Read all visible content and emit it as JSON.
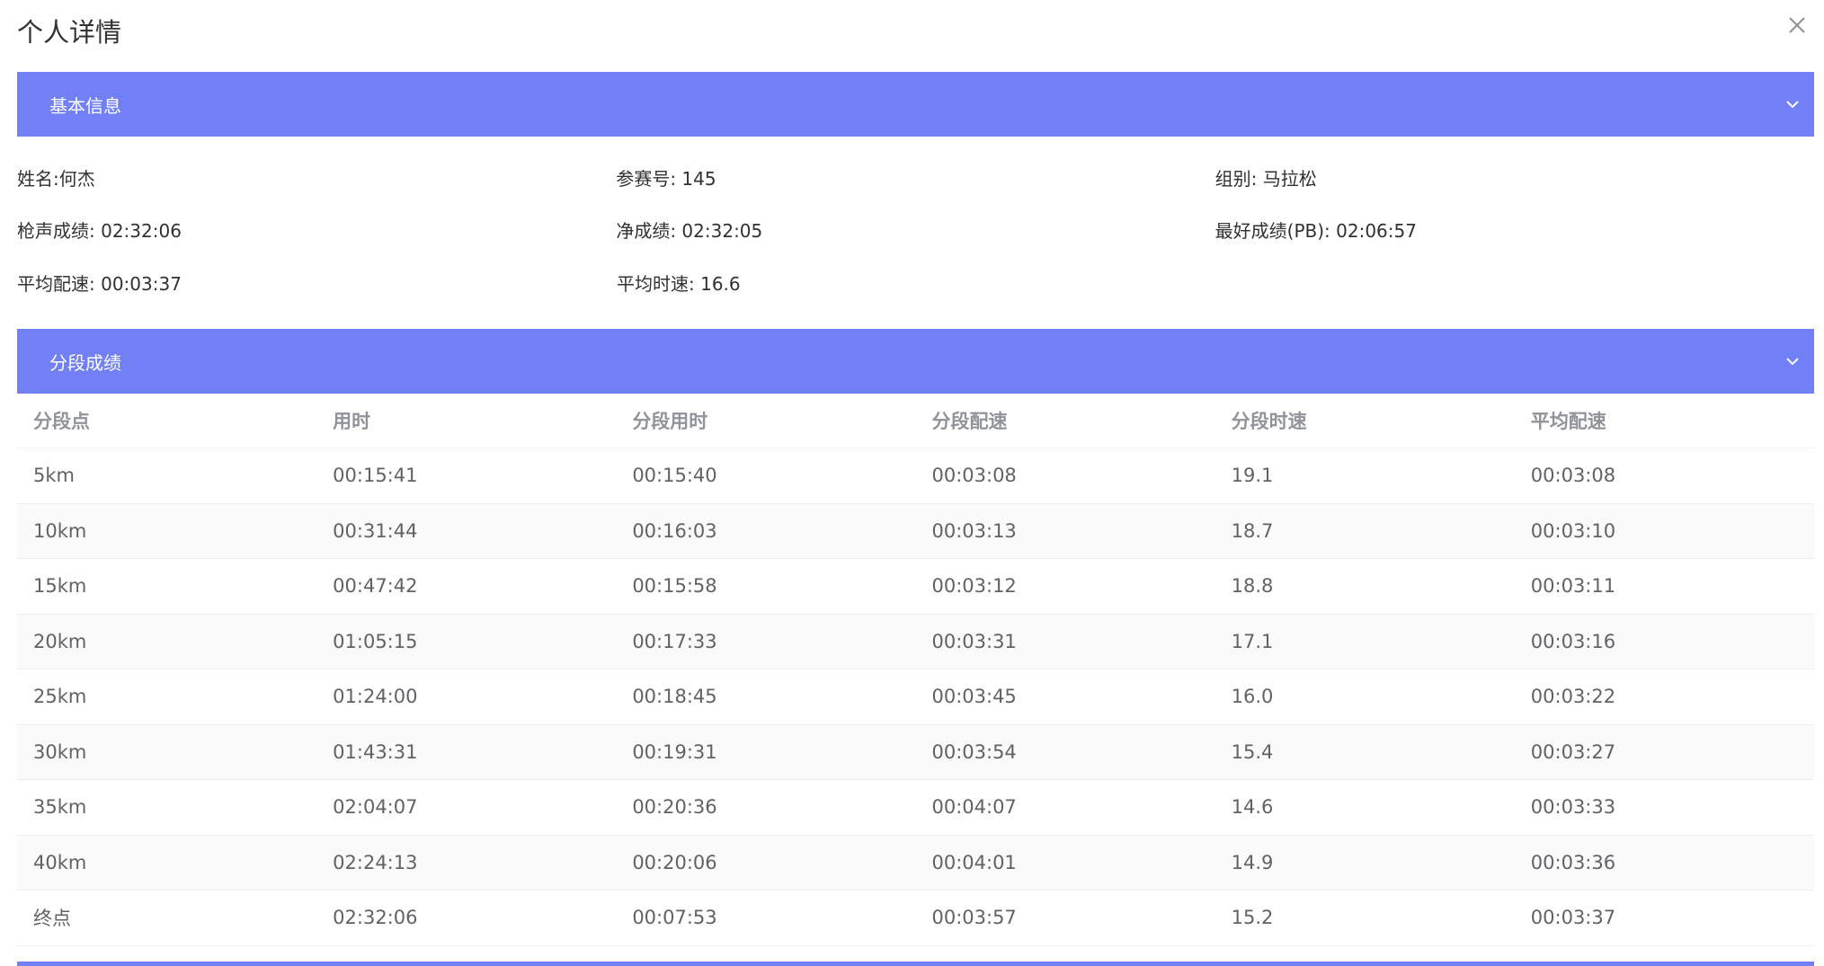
{
  "dialog": {
    "title": "个人详情"
  },
  "basic_panel": {
    "title": "基本信息",
    "rows": [
      [
        {
          "label": "姓名:",
          "value": "何杰"
        },
        {
          "label": "参赛号:",
          "value": " 145"
        },
        {
          "label": "组别:",
          "value": " 马拉松"
        }
      ],
      [
        {
          "label": "枪声成绩:",
          "value": " 02:32:06"
        },
        {
          "label": "净成绩:",
          "value": " 02:32:05"
        },
        {
          "label": "最好成绩(PB):",
          "value": " 02:06:57"
        }
      ],
      [
        {
          "label": "平均配速:",
          "value": " 00:03:37"
        },
        {
          "label": "平均时速:",
          "value": " 16.6"
        }
      ]
    ]
  },
  "split_panel": {
    "title": "分段成绩",
    "columns": [
      "分段点",
      "用时",
      "分段用时",
      "分段配速",
      "分段时速",
      "平均配速"
    ],
    "rows": [
      [
        "5km",
        "00:15:41",
        "00:15:40",
        "00:03:08",
        "19.1",
        "00:03:08"
      ],
      [
        "10km",
        "00:31:44",
        "00:16:03",
        "00:03:13",
        "18.7",
        "00:03:10"
      ],
      [
        "15km",
        "00:47:42",
        "00:15:58",
        "00:03:12",
        "18.8",
        "00:03:11"
      ],
      [
        "20km",
        "01:05:15",
        "00:17:33",
        "00:03:31",
        "17.1",
        "00:03:16"
      ],
      [
        "25km",
        "01:24:00",
        "00:18:45",
        "00:03:45",
        "16.0",
        "00:03:22"
      ],
      [
        "30km",
        "01:43:31",
        "00:19:31",
        "00:03:54",
        "15.4",
        "00:03:27"
      ],
      [
        "35km",
        "02:04:07",
        "00:20:36",
        "00:04:07",
        "14.6",
        "00:03:33"
      ],
      [
        "40km",
        "02:24:13",
        "00:20:06",
        "00:04:01",
        "14.9",
        "00:03:36"
      ],
      [
        "终点",
        "02:32:06",
        "00:07:53",
        "00:03:57",
        "15.2",
        "00:03:37"
      ]
    ]
  },
  "icons": {
    "close": "close-icon",
    "collapse": "chevron-down-icon"
  },
  "colors": {
    "accent": "#7280f6",
    "header_text": "#ffffff",
    "table_header_text": "#909399",
    "table_cell_text": "#606266",
    "stripe": "#fafafa"
  }
}
